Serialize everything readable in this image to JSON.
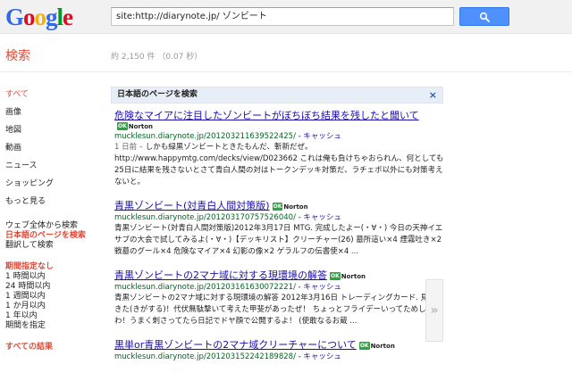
{
  "header": {
    "logo_letters": [
      {
        "ch": "G",
        "color": "#3369e8"
      },
      {
        "ch": "o",
        "color": "#d50f25"
      },
      {
        "ch": "o",
        "color": "#eeb211"
      },
      {
        "ch": "g",
        "color": "#3369e8"
      },
      {
        "ch": "l",
        "color": "#009925"
      },
      {
        "ch": "e",
        "color": "#d50f25"
      }
    ],
    "query": "site:http://diarynote.jp/ ゾンビート",
    "search_icon": "magnifier-icon"
  },
  "bar2": {
    "label": "検索",
    "stats": "約 2,150 件 （0.07 秒）"
  },
  "leftnav": {
    "types": [
      {
        "label": "すべて",
        "selected": true
      },
      {
        "label": "画像",
        "selected": false
      },
      {
        "label": "地図",
        "selected": false
      },
      {
        "label": "動画",
        "selected": false
      },
      {
        "label": "ニュース",
        "selected": false
      },
      {
        "label": "ショッピング",
        "selected": false
      },
      {
        "label": "もっと見る",
        "selected": false
      }
    ],
    "language": [
      {
        "label": "ウェブ全体から検索",
        "selected": false
      },
      {
        "label": "日本語のページを検索",
        "selected": true
      },
      {
        "label": "翻訳して検索",
        "selected": false
      }
    ],
    "period_head": "期間指定なし",
    "periods": [
      "1 時間以内",
      "24 時間以内",
      "1 週間以内",
      "1 か月以内",
      "1 年以内",
      "期間を指定"
    ],
    "results_head": "すべての結果"
  },
  "lang_banner": {
    "label": "日本語のページを検索",
    "close": "×"
  },
  "results": [
    {
      "title": "危険なマイアに注目したゾンビートがぼちぼち結果を残したと聞いて",
      "url": "mucklesun.diarynote.jp/201203211639522425/",
      "cache": " - キャッシュ",
      "snippet": [
        {
          "date": "1 日前 – ",
          "text": "しかも緑黒ゾンビートときたもんだ、斬新だぜ。"
        },
        {
          "date": "",
          "text": "http://www.happymtg.com/decks/view/D023662 これは俺も負けちゃおられん、何としても25日に結果を残さないとさて青白人間の対はトークンデッキ対策だ、ラチェボ以外にも対策考えないと。"
        }
      ]
    },
    {
      "title": "青黒ゾンビート(対青白人間対策版)",
      "url": "mucklesun.diarynote.jp/201203170757526040/",
      "cache": " - キャッシュ",
      "snippet": [
        {
          "date": "",
          "text": "青黒ゾンビート(対青白人間対策版)2012年3月17日 MTG. 完成したよー(・∀・) 今日の天神イエサブの大会で試してみるよ(・∀・)【デッキリスト】クリーチャー(26) 墓所這い×4 煙霧吐き×2 戦墓のグール×4 危険なマイア×4 幻影の像×2 ゲラルフの伝書使×4 ..."
        }
      ]
    },
    {
      "title": "青黒ゾンビートの2マナ域に対する現環境の解答",
      "url": "mucklesun.diarynote.jp/201203161630072221/",
      "cache": " - キャッシュ",
      "snippet": [
        {
          "date": "",
          "text": "青黒ゾンビートの2マナ域に対する現環境の解答 2012年3月16日 トレーディングカード. 見えてきた(きがする)！代伏無駄撃いて考えた甲斐があったぜ！ ちょっとフライデーいってためしてくわ！うまく刺さってたら日記でドヤ顔で公開するよ！ (使敢なるお蔵 ..."
        }
      ]
    },
    {
      "title": "黒単or青黒ゾンビートの2マナ域クリーチャーについて",
      "url": "mucklesun.diarynote.jp/201203152242189828/",
      "cache": " - キャッシュ",
      "snippet": []
    }
  ],
  "norton_label": "Norton",
  "norton_ok": "OK",
  "preview_arrow": "»"
}
